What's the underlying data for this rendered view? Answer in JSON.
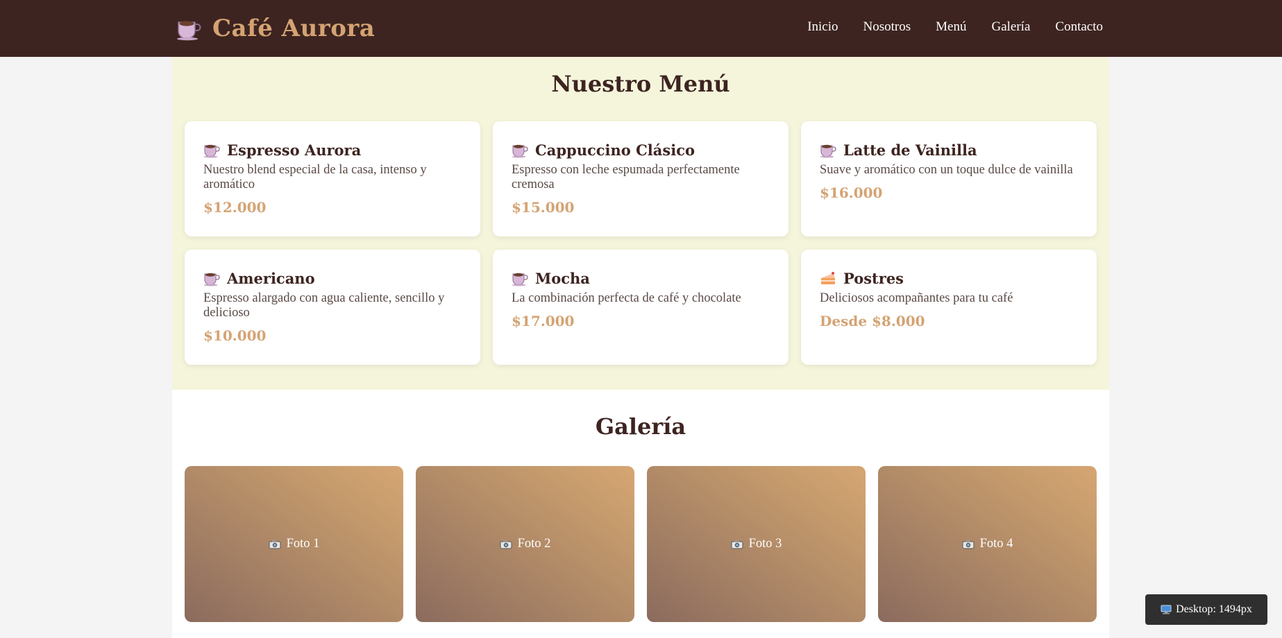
{
  "brand": {
    "name": "Café Aurora",
    "icon": "coffee-cup-icon"
  },
  "nav": {
    "items": [
      {
        "label": "Inicio"
      },
      {
        "label": "Nosotros"
      },
      {
        "label": "Menú"
      },
      {
        "label": "Galería"
      },
      {
        "label": "Contacto"
      }
    ]
  },
  "menu": {
    "title": "Nuestro Menú",
    "items": [
      {
        "icon": "coffee-cup-icon",
        "name": "Espresso Aurora",
        "description": "Nuestro blend especial de la casa, intenso y aromático",
        "price": "$12.000"
      },
      {
        "icon": "coffee-cup-icon",
        "name": "Cappuccino Clásico",
        "description": "Espresso con leche espumada perfectamente cremosa",
        "price": "$15.000"
      },
      {
        "icon": "coffee-cup-icon",
        "name": "Latte de Vainilla",
        "description": "Suave y aromático con un toque dulce de vainilla",
        "price": "$16.000"
      },
      {
        "icon": "coffee-cup-icon",
        "name": "Americano",
        "description": "Espresso alargado con agua caliente, sencillo y delicioso",
        "price": "$10.000"
      },
      {
        "icon": "coffee-cup-icon",
        "name": "Mocha",
        "description": "La combinación perfecta de café y chocolate",
        "price": "$17.000"
      },
      {
        "icon": "cake-slice-icon",
        "name": "Postres",
        "description": "Deliciosos acompañantes para tu café",
        "price": "Desde $8.000"
      }
    ]
  },
  "gallery": {
    "title": "Galería",
    "photos": [
      {
        "label": "Foto 1",
        "icon": "camera-icon"
      },
      {
        "label": "Foto 2",
        "icon": "camera-icon"
      },
      {
        "label": "Foto 3",
        "icon": "camera-icon"
      },
      {
        "label": "Foto 4",
        "icon": "camera-icon"
      }
    ]
  },
  "viewport_badge": {
    "label": "Desktop: 1494px",
    "icon": "computer-icon"
  },
  "colors": {
    "header": "#3d2420",
    "accent": "#d4a373",
    "menu_background": "#f5f5dc",
    "page_background": "#f4f4f4"
  }
}
